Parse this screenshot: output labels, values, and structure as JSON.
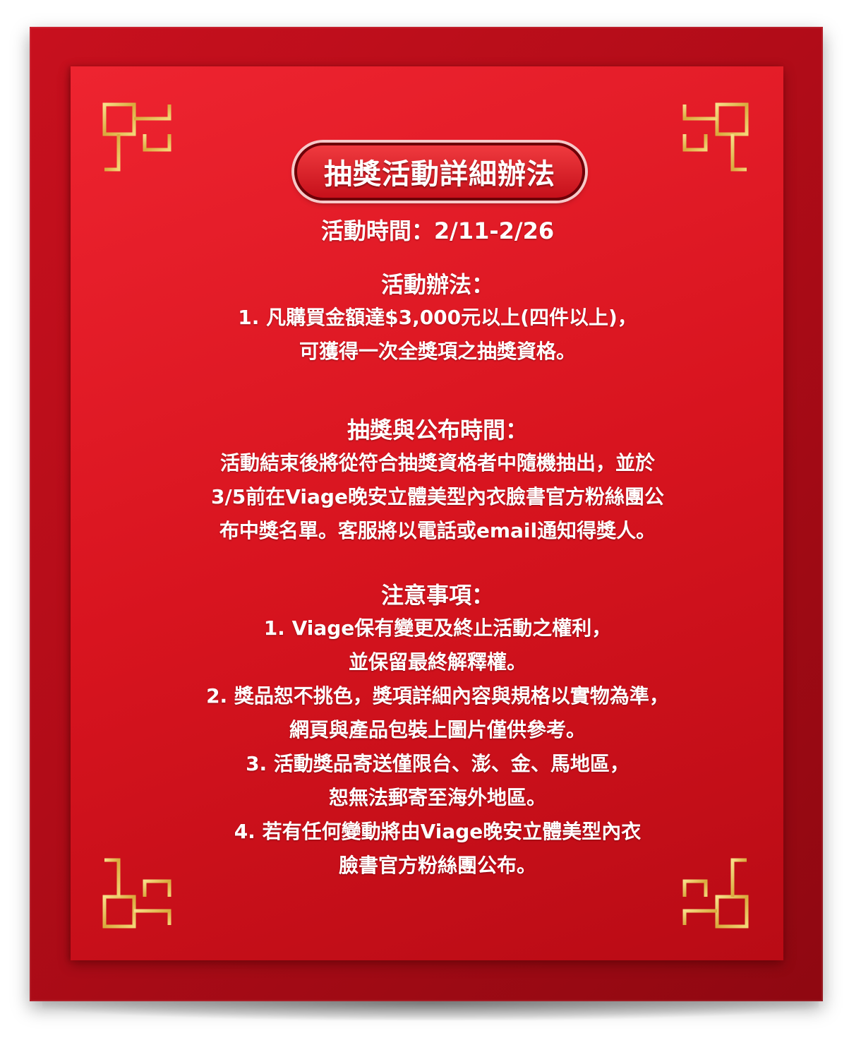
{
  "title": "抽獎活動詳細辦法",
  "period": "活動時間：2/11-2/26",
  "method": {
    "heading": "活動辦法：",
    "lines": [
      "1. 凡購買金額達$3,000元以上(四件以上)，",
      "可獲得一次全獎項之抽獎資格。"
    ]
  },
  "announcement": {
    "heading": "抽獎與公布時間：",
    "lines": [
      "活動結束後將從符合抽獎資格者中隨機抽出，並於",
      "3/5前在Viage晚安立體美型內衣臉書官方粉絲團公",
      "布中獎名單。客服將以電話或email通知得獎人。"
    ]
  },
  "notes": {
    "heading": "注意事項：",
    "lines": [
      "1. Viage保有變更及終止活動之權利，",
      "並保留最終解釋權。",
      "2. 獎品恕不挑色，獎項詳細內容與規格以實物為準，",
      "網頁與產品包裝上圖片僅供參考。",
      "3. 活動獎品寄送僅限台、澎、金、馬地區，",
      "恕無法郵寄至海外地區。",
      "4. 若有任何變動將由Viage晚安立體美型內衣",
      "臉書官方粉絲團公布。"
    ]
  },
  "colors": {
    "red": "#d8141f",
    "dark_red": "#8f0811",
    "gold": "#e7c25a"
  }
}
